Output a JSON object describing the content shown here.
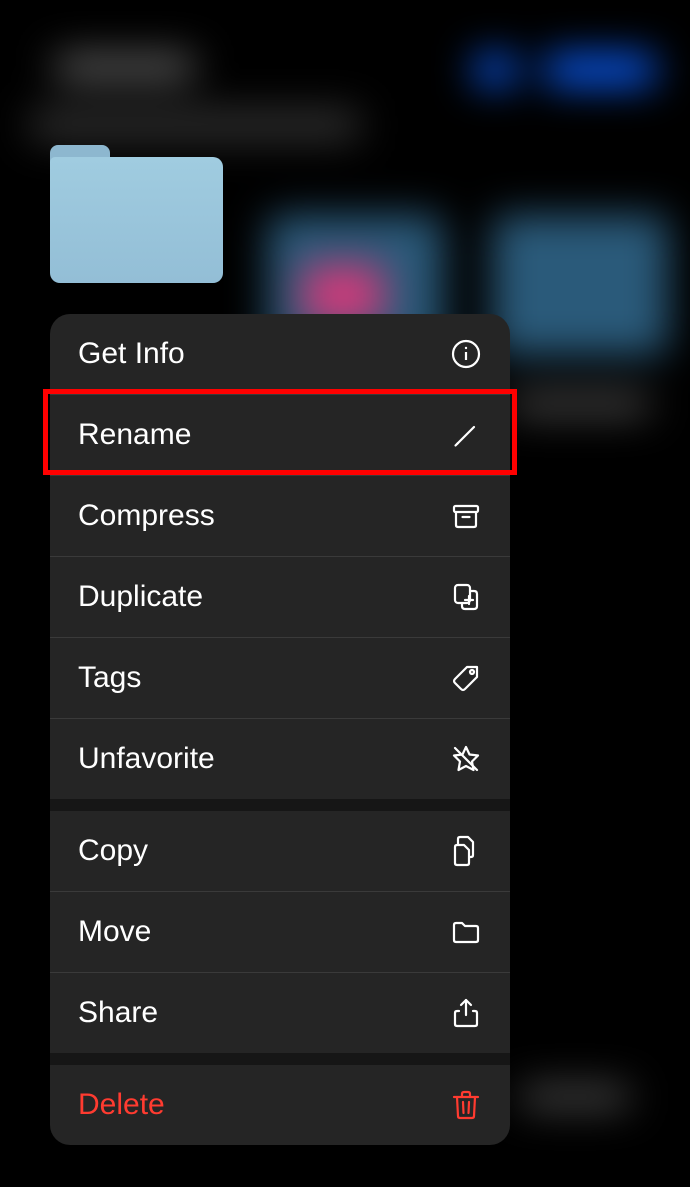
{
  "menu": {
    "items": [
      {
        "label": "Get Info",
        "icon": "info-circle"
      },
      {
        "label": "Rename",
        "icon": "pencil"
      },
      {
        "label": "Compress",
        "icon": "archivebox"
      },
      {
        "label": "Duplicate",
        "icon": "duplicate"
      },
      {
        "label": "Tags",
        "icon": "tag"
      },
      {
        "label": "Unfavorite",
        "icon": "star-slash"
      },
      {
        "label": "Copy",
        "icon": "doc-on-doc"
      },
      {
        "label": "Move",
        "icon": "folder"
      },
      {
        "label": "Share",
        "icon": "share"
      },
      {
        "label": "Delete",
        "icon": "trash"
      }
    ]
  },
  "highlighted_item": "Rename"
}
